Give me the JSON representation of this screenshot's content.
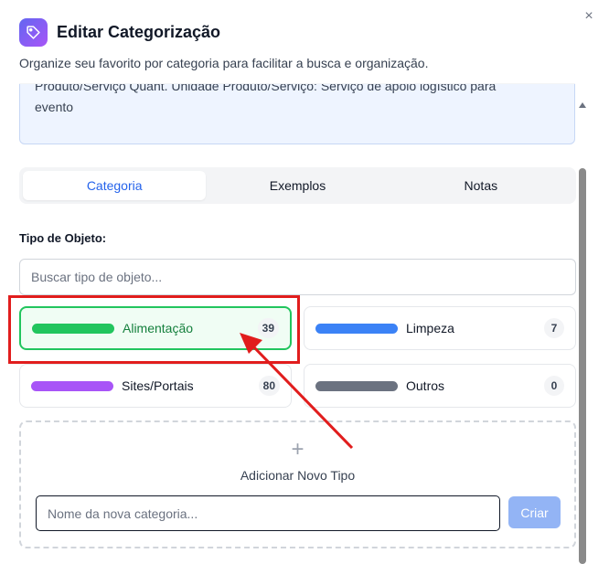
{
  "dialog": {
    "title": "Editar Categorização",
    "subtitle": "Organize seu favorito por categoria para facilitar a busca e organização.",
    "close_glyph": "×",
    "icon": "tag-icon"
  },
  "info_box": {
    "line1": "Produto/Serviço Quant. Unidade Produto/Serviço: Serviço de apoio logístico para",
    "line2": "evento"
  },
  "tabs": [
    {
      "label": "Categoria",
      "active": true
    },
    {
      "label": "Exemplos",
      "active": false
    },
    {
      "label": "Notas",
      "active": false
    }
  ],
  "object_type": {
    "label": "Tipo de Objeto:",
    "search_placeholder": "Buscar tipo de objeto..."
  },
  "categories": [
    {
      "name": "Alimentação",
      "count": "39",
      "color": "#22c55e",
      "selected": true
    },
    {
      "name": "Limpeza",
      "count": "7",
      "color": "#3b82f6",
      "selected": false
    },
    {
      "name": "Sites/Portais",
      "count": "80",
      "color": "#a855f7",
      "selected": false
    },
    {
      "name": "Outros",
      "count": "0",
      "color": "#6b7280",
      "selected": false
    }
  ],
  "add_new": {
    "plus_glyph": "+",
    "label": "Adicionar Novo Tipo",
    "input_placeholder": "Nome da nova categoria...",
    "button_label": "Criar"
  },
  "colors": {
    "accent": "#2563eb",
    "selected_border": "#22c55e",
    "annotation": "#e11d1d"
  }
}
